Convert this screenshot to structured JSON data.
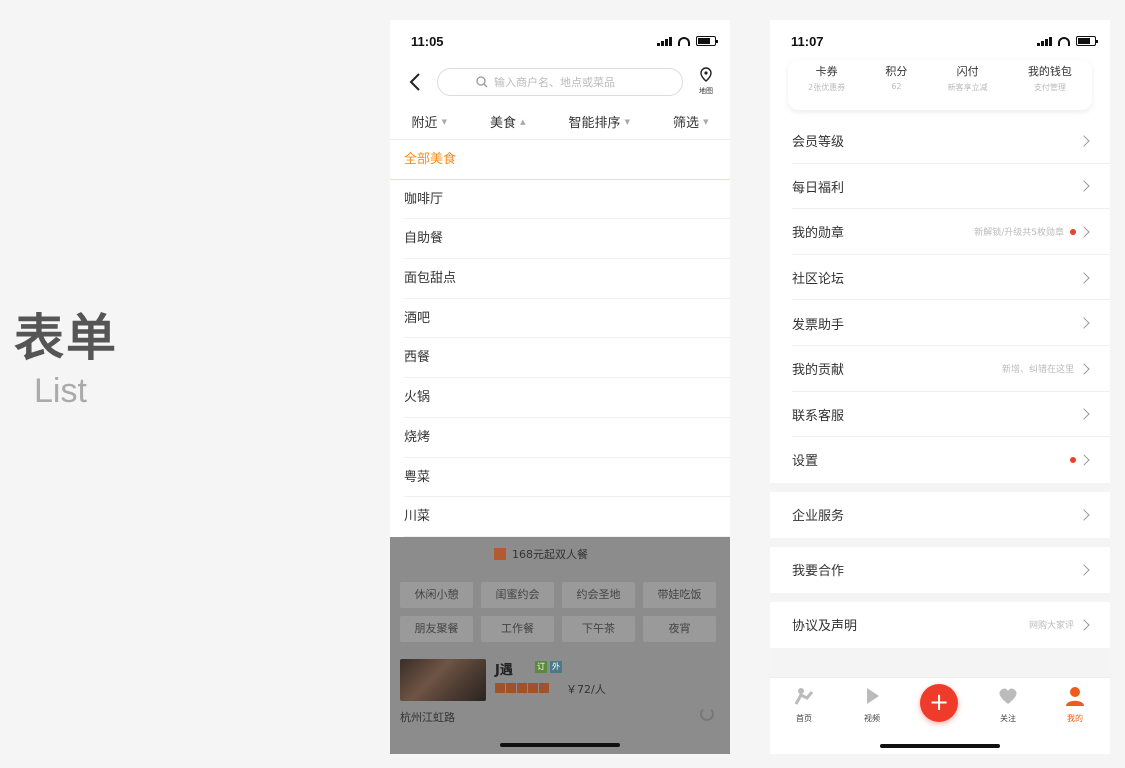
{
  "hero": {
    "title": "表单",
    "subtitle": "List"
  },
  "phone1": {
    "time": "11:05",
    "search_placeholder": "输入商户名、地点或菜品",
    "map_label": "地图",
    "filters": [
      "附近",
      "美食",
      "智能排序",
      "筛选"
    ],
    "categories": [
      "全部美食",
      "咖啡厅",
      "自助餐",
      "面包甜点",
      "酒吧",
      "西餐",
      "火锅",
      "烧烤",
      "粤菜",
      "川菜"
    ],
    "promo": "168元起双人餐",
    "tags": [
      "休闲小憩",
      "闺蜜约会",
      "约会圣地",
      "带娃吃饭",
      "朋友聚餐",
      "工作餐",
      "下午茶",
      "夜宵"
    ],
    "shop": {
      "name": "J遇",
      "badge1": "订",
      "badge2": "外",
      "price": "￥72/人",
      "location": "杭州江虹路",
      "rating": 5
    }
  },
  "phone2": {
    "time": "11:07",
    "cards": [
      {
        "title": "卡券",
        "sub": "2张优惠券"
      },
      {
        "title": "积分",
        "sub": "62"
      },
      {
        "title": "闪付",
        "sub": "新客享立减"
      },
      {
        "title": "我的钱包",
        "sub": "支付管理"
      }
    ],
    "menu": [
      {
        "label": "会员等级",
        "hint": ""
      },
      {
        "label": "每日福利",
        "hint": ""
      },
      {
        "label": "我的勋章",
        "hint": "新解锁/升级共5枚勋章"
      },
      {
        "label": "社区论坛",
        "hint": ""
      },
      {
        "label": "发票助手",
        "hint": ""
      },
      {
        "label": "我的贡献",
        "hint": "新增、纠错在这里"
      },
      {
        "label": "联系客服",
        "hint": ""
      },
      {
        "label": "设置",
        "hint": ""
      }
    ],
    "menu2": [
      {
        "label": "企业服务"
      }
    ],
    "menu3": [
      {
        "label": "我要合作"
      }
    ],
    "menu4": [
      {
        "label": "协议及声明",
        "hint": "网购大家评"
      }
    ],
    "tabs": [
      "首页",
      "视频",
      "关注",
      "我的"
    ],
    "accent": "#ef3b2a"
  }
}
